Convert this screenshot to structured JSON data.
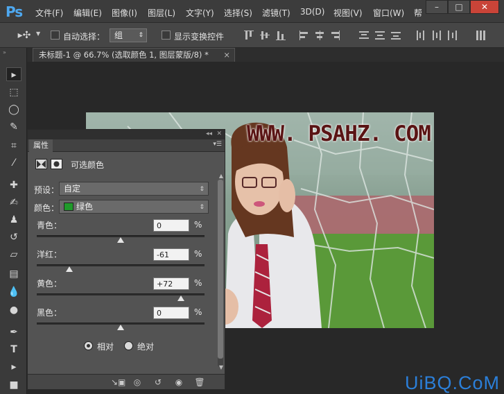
{
  "app": {
    "logo": "Ps"
  },
  "menu": [
    "文件(F)",
    "编辑(E)",
    "图像(I)",
    "图层(L)",
    "文字(Y)",
    "选择(S)",
    "滤镜(T)",
    "3D(D)",
    "视图(V)",
    "窗口(W)",
    "帮"
  ],
  "window_controls": {
    "minimize": "–",
    "maximize": "□",
    "close": "✕"
  },
  "options": {
    "auto_select_label": "自动选择：",
    "auto_select_value": "组",
    "show_transform_label": "显示变换控件"
  },
  "document_tab": {
    "title": "未标题-1 @ 66.7% (选取颜色 1, 图层蒙版/8) *",
    "close": "×"
  },
  "photo": {
    "watermark_text": "WWW. PSAHZ. COM"
  },
  "panel": {
    "collapse": "◂◂",
    "close": "✕",
    "tab": "属性",
    "layer_name": "可选颜色",
    "preset_label": "预设：",
    "preset_value": "自定",
    "colors_label": "颜色：",
    "colors_value": "绿色",
    "colors_swatch": "#1f9a2a",
    "sliders": [
      {
        "label": "青色：",
        "value": "0",
        "unit": "%",
        "amount": 0
      },
      {
        "label": "洋红：",
        "value": "-61",
        "unit": "%",
        "amount": -61
      },
      {
        "label": "黄色：",
        "value": "+72",
        "unit": "%",
        "amount": 72
      },
      {
        "label": "黑色：",
        "value": "0",
        "unit": "%",
        "amount": 0
      }
    ],
    "radio_relative": "相对",
    "radio_absolute": "绝对",
    "relative_selected": true
  },
  "site_watermark": "UiBQ.CoM"
}
